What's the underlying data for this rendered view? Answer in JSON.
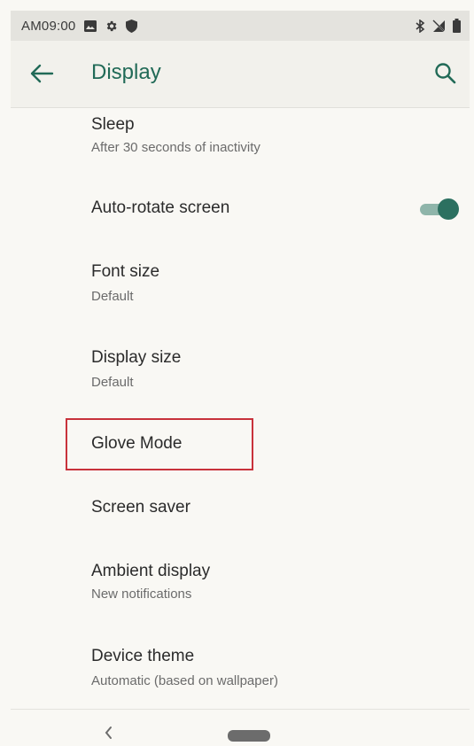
{
  "status_bar": {
    "time": "AM09:00",
    "left_icons": [
      "image-icon",
      "gear-icon",
      "shield-icon"
    ],
    "right_icons": [
      "bluetooth-icon",
      "no-signal-icon",
      "battery-icon"
    ]
  },
  "app_bar": {
    "title": "Display",
    "back_icon": "arrow-left-icon",
    "search_icon": "search-icon"
  },
  "settings": [
    {
      "title": "Sleep",
      "subtitle": "After 30 seconds of inactivity"
    },
    {
      "title": "Auto-rotate screen",
      "toggle_on": true
    },
    {
      "title": "Font size",
      "subtitle": "Default"
    },
    {
      "title": "Display size",
      "subtitle": "Default"
    },
    {
      "title": "Glove Mode",
      "highlighted": true
    },
    {
      "title": "Screen saver"
    },
    {
      "title": "Ambient display",
      "subtitle": "New notifications"
    },
    {
      "title": "Device theme",
      "subtitle": "Automatic (based on wallpaper)"
    }
  ],
  "nav_bar": {
    "back_icon": "chevron-left-icon",
    "home_icon": "home-pill-icon"
  },
  "colors": {
    "accent": "#216a57",
    "toggle_thumb": "#2c7060",
    "toggle_track": "#8fb5aa",
    "highlight": "#c8323b",
    "background": "#f9f8f4",
    "status_bar": "#e4e3de"
  }
}
